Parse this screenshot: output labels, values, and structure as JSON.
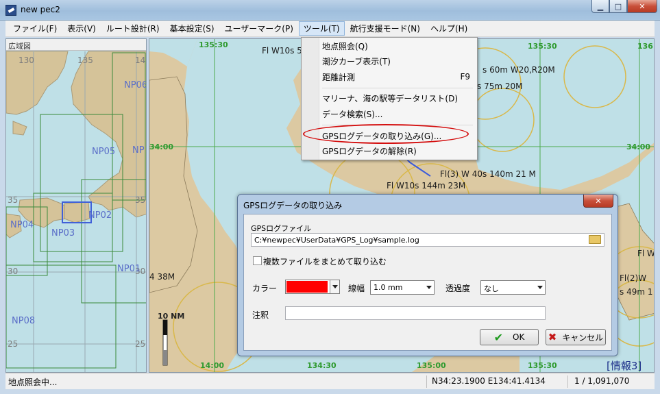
{
  "window": {
    "title": "new pec2",
    "minimize": "▁",
    "maximize": "□",
    "close": "✕"
  },
  "menubar": [
    "ファイル(F)",
    "表示(V)",
    "ルート設計(R)",
    "基本設定(S)",
    "ユーザーマーク(P)",
    "ツール(T)",
    "航行支援モード(N)",
    "ヘルプ(H)"
  ],
  "tool_menu": {
    "items": [
      {
        "label": "地点照会(Q)",
        "shortcut": ""
      },
      {
        "label": "潮汐カーブ表示(T)",
        "shortcut": ""
      },
      {
        "label": "距離計測",
        "shortcut": "F9"
      },
      {
        "label": "マリーナ、海の駅等データリスト(D)",
        "shortcut": ""
      },
      {
        "label": "データ検索(S)...",
        "shortcut": ""
      },
      {
        "label": "GPSログデータの取り込み(G)...",
        "shortcut": ""
      },
      {
        "label": "GPSログデータの解除(R)",
        "shortcut": ""
      }
    ]
  },
  "overview": {
    "title": "広域図",
    "lon_labels": [
      "130",
      "135",
      "14"
    ],
    "lat_labels": [
      "35",
      "30",
      "25",
      "35",
      "30",
      "25"
    ],
    "areas": [
      "NP06",
      "NP05",
      "NP",
      "NP04",
      "NP02",
      "NP03",
      "NP01",
      "NP08"
    ]
  },
  "chart": {
    "grid_labels": [
      "135:30",
      "136",
      "34:00",
      "34:00",
      "14:00",
      "134:30",
      "135:00",
      "135:30",
      "135:30"
    ],
    "lights": [
      "Fl W10s 5",
      "s 60m W20,R20M",
      "s 75m 20M",
      "Fl(3) W 40s 140m 21 M",
      "Fl W10s 144m 23M",
      "Fl W",
      "Fl(2)W",
      "s 49m 1",
      "4 38M"
    ],
    "scale": "10 NM",
    "info": "[情報3]"
  },
  "dialog": {
    "title": "GPSログデータの取り込み",
    "close": "✕",
    "file_label": "GPSログファイル",
    "file_path": "C:¥newpec¥UserData¥GPS_Log¥sample.log",
    "multi_file_label": "複数ファイルをまとめて取り込む",
    "color_label": "カラー",
    "color_value": "#ff0000",
    "line_width_label": "線幅",
    "line_width_value": "1.0 mm",
    "transparency_label": "透過度",
    "transparency_value": "なし",
    "note_label": "注釈",
    "ok_label": "OK",
    "cancel_label": "キャンセル"
  },
  "statusbar": {
    "message": "地点照会中...",
    "coords": "N34:23.1900 E134:41.4134",
    "scale": "1 / 1,091,070"
  },
  "colors": {
    "sea": "#bfe0e7",
    "land": "#dcc9a2",
    "grid": "#2f9a2f",
    "highlight": "#d41010",
    "area_label": "#5a6ec8"
  }
}
